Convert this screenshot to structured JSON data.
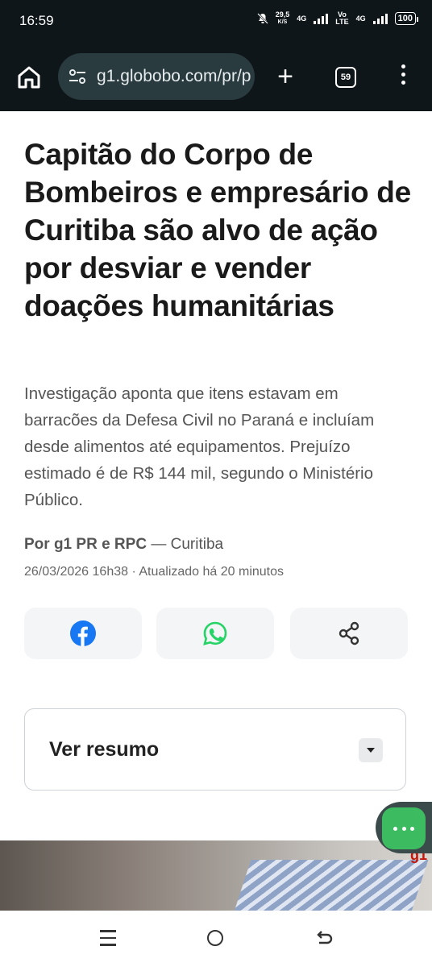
{
  "status_bar": {
    "time": "16:59",
    "net_speed_value": "29,5",
    "net_speed_unit": "K/S",
    "network_1": "4G",
    "volte_top": "Vo",
    "volte_bottom": "LTE",
    "network_2": "4G",
    "battery": "100"
  },
  "browser": {
    "url": "g1.globobo.com/pr/p",
    "tab_count": "59"
  },
  "article": {
    "headline": "Capitão do Corpo de Bombeiros e empresário de Curitiba são alvo de ação por desviar e vender doações humanitárias",
    "subtitle": "Investigação aponta que itens estavam em barracões da Defesa Civil no Paraná e incluíam desde alimentos até equipamentos. Prejuízo estimado é de R$ 144 mil, segundo o Ministério Público.",
    "author": "Por g1 PR e RPC",
    "location": " — Curitiba",
    "date": "26/03/2026 16h38 · Atualizado há 20 minutos"
  },
  "share": {
    "icons": [
      "facebook-icon",
      "whatsapp-icon",
      "share-icon"
    ],
    "colors": {
      "facebook": "#1877f2",
      "whatsapp": "#25d366"
    }
  },
  "summary": {
    "label": "Ver resumo"
  },
  "photo": {
    "logo": "g1"
  }
}
